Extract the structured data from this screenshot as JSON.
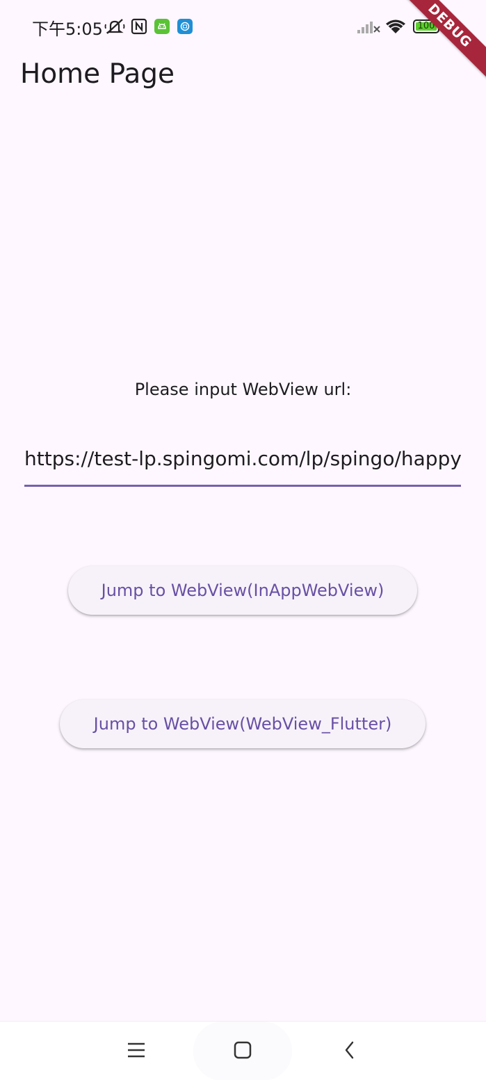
{
  "status_bar": {
    "time": "下午5:05",
    "battery_level": "100",
    "battery_fraction": 1.0,
    "icons": [
      "mute-icon",
      "nfc-icon",
      "android-app-icon",
      "store-app-icon",
      "signal-icon",
      "wifi-icon",
      "battery-icon",
      "bolt-icon"
    ],
    "app_badge_colors": [
      "#5bc236",
      "#1f8fd6"
    ]
  },
  "debug_banner": "DEBUG",
  "app_bar": {
    "title": "Home Page"
  },
  "form": {
    "prompt": "Please input WebView url:",
    "url_value": "https://test-lp.spingomi.com/lp/spingo/happy"
  },
  "buttons": {
    "inapp_label": "Jump to WebView(InAppWebView)",
    "flutter_label": "Jump to WebView(WebView_Flutter)"
  },
  "nav_bar": {
    "items": [
      "menu-icon",
      "home-icon",
      "back-icon"
    ]
  },
  "colors": {
    "background": "#fef7ff",
    "accent": "#6750a4",
    "button_bg": "#f7f2fa",
    "debug_banner": "#a8263b"
  }
}
